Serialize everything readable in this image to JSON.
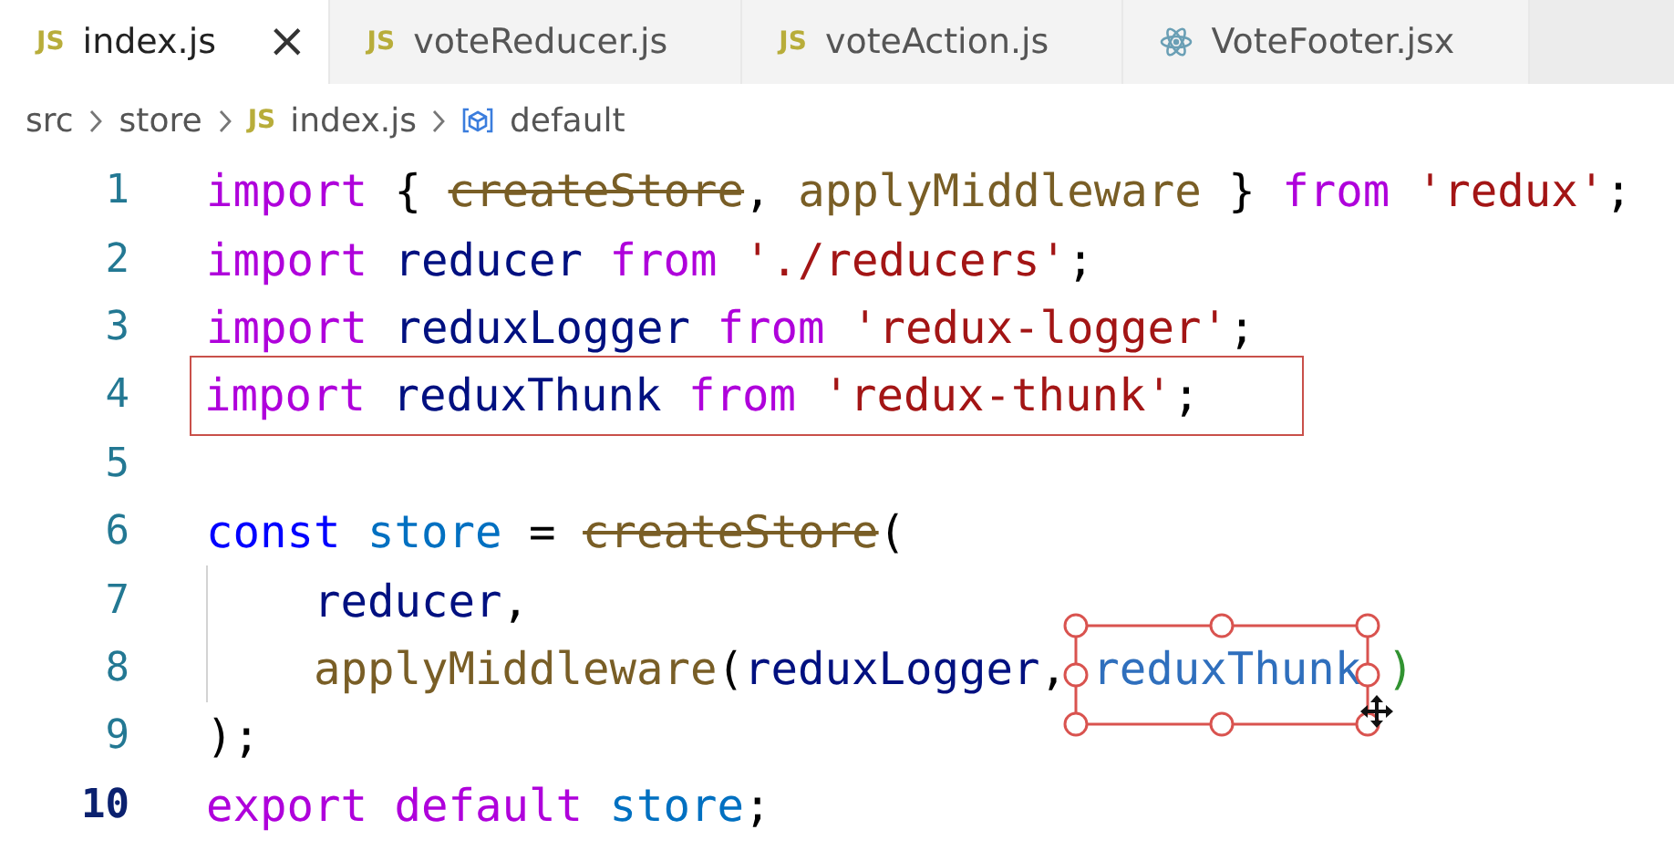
{
  "tabs": [
    {
      "label": "index.js",
      "kind": "js",
      "badge": "JS",
      "selected": true,
      "close": "×"
    },
    {
      "label": "voteReducer.js",
      "kind": "js",
      "badge": "JS",
      "selected": false
    },
    {
      "label": "voteAction.js",
      "kind": "js",
      "badge": "JS",
      "selected": false
    },
    {
      "label": "VoteFooter.jsx",
      "kind": "react",
      "selected": false
    }
  ],
  "breadcrumb": [
    {
      "kind": "folder",
      "label": "src"
    },
    {
      "kind": "folder",
      "label": "store"
    },
    {
      "kind": "js",
      "label": "index.js",
      "badge": "JS"
    },
    {
      "kind": "symbol",
      "label": "default"
    }
  ],
  "lines": [
    {
      "number": "1",
      "current": false,
      "boxed": false,
      "indented": false,
      "tokens": [
        {
          "kind": "keyword",
          "text": "import"
        },
        {
          "kind": "punct",
          "text": " { "
        },
        {
          "kind": "deprecated",
          "text": "createStore"
        },
        {
          "kind": "punct",
          "text": ", "
        },
        {
          "kind": "function",
          "text": "applyMiddleware"
        },
        {
          "kind": "punct",
          "text": " } "
        },
        {
          "kind": "keyword",
          "text": "from "
        },
        {
          "kind": "string",
          "text": "'redux'"
        },
        {
          "kind": "punct",
          "text": ";"
        }
      ]
    },
    {
      "number": "2",
      "current": false,
      "boxed": false,
      "indented": false,
      "tokens": [
        {
          "kind": "keyword",
          "text": "import "
        },
        {
          "kind": "variable",
          "text": "reducer "
        },
        {
          "kind": "keyword",
          "text": "from "
        },
        {
          "kind": "string",
          "text": "'./reducers'"
        },
        {
          "kind": "punct",
          "text": ";"
        }
      ]
    },
    {
      "number": "3",
      "current": false,
      "boxed": false,
      "indented": false,
      "tokens": [
        {
          "kind": "keyword",
          "text": "import "
        },
        {
          "kind": "variable",
          "text": "reduxLogger "
        },
        {
          "kind": "keyword",
          "text": "from "
        },
        {
          "kind": "string",
          "text": "'redux-logger'"
        },
        {
          "kind": "punct",
          "text": ";"
        }
      ]
    },
    {
      "number": "4",
      "current": false,
      "boxed": true,
      "indented": false,
      "tokens": [
        {
          "kind": "keyword",
          "text": "import "
        },
        {
          "kind": "variable",
          "text": "reduxThunk "
        },
        {
          "kind": "keyword",
          "text": "from "
        },
        {
          "kind": "string",
          "text": "'redux-thunk'"
        },
        {
          "kind": "punct",
          "text": ";"
        }
      ]
    },
    {
      "number": "5",
      "current": false,
      "boxed": false,
      "indented": false
    },
    {
      "number": "6",
      "current": false,
      "boxed": false,
      "indented": false,
      "tokens": [
        {
          "kind": "storage",
          "text": "const "
        },
        {
          "kind": "constant",
          "text": "store"
        },
        {
          "kind": "punct",
          "text": " = "
        },
        {
          "kind": "deprecated",
          "text": "createStore"
        },
        {
          "kind": "punct",
          "text": "("
        }
      ]
    },
    {
      "number": "7",
      "current": false,
      "boxed": false,
      "indented": true,
      "tokens": [
        {
          "kind": "variable",
          "text": "reducer"
        },
        {
          "kind": "punct",
          "text": ","
        }
      ]
    },
    {
      "number": "8",
      "current": false,
      "boxed": false,
      "indented": true,
      "tokens": [
        {
          "kind": "function",
          "text": "applyMiddleware"
        },
        {
          "kind": "punct",
          "text": "("
        },
        {
          "kind": "variable",
          "text": "reduxLogger"
        },
        {
          "kind": "punct",
          "text": ","
        },
        {
          "kind": "textbox",
          "text": "reduxThunk"
        },
        {
          "kind": "paren",
          "text": ")"
        }
      ]
    },
    {
      "number": "9",
      "current": false,
      "boxed": false,
      "indented": false,
      "tokens": [
        {
          "kind": "punct",
          "text": ");"
        }
      ]
    },
    {
      "number": "10",
      "current": true,
      "boxed": false,
      "indented": false,
      "tokens": [
        {
          "kind": "keyword",
          "text": "export "
        },
        {
          "kind": "keyword",
          "text": "default "
        },
        {
          "kind": "constant",
          "text": "store"
        },
        {
          "kind": "punct",
          "text": ";"
        }
      ]
    }
  ]
}
